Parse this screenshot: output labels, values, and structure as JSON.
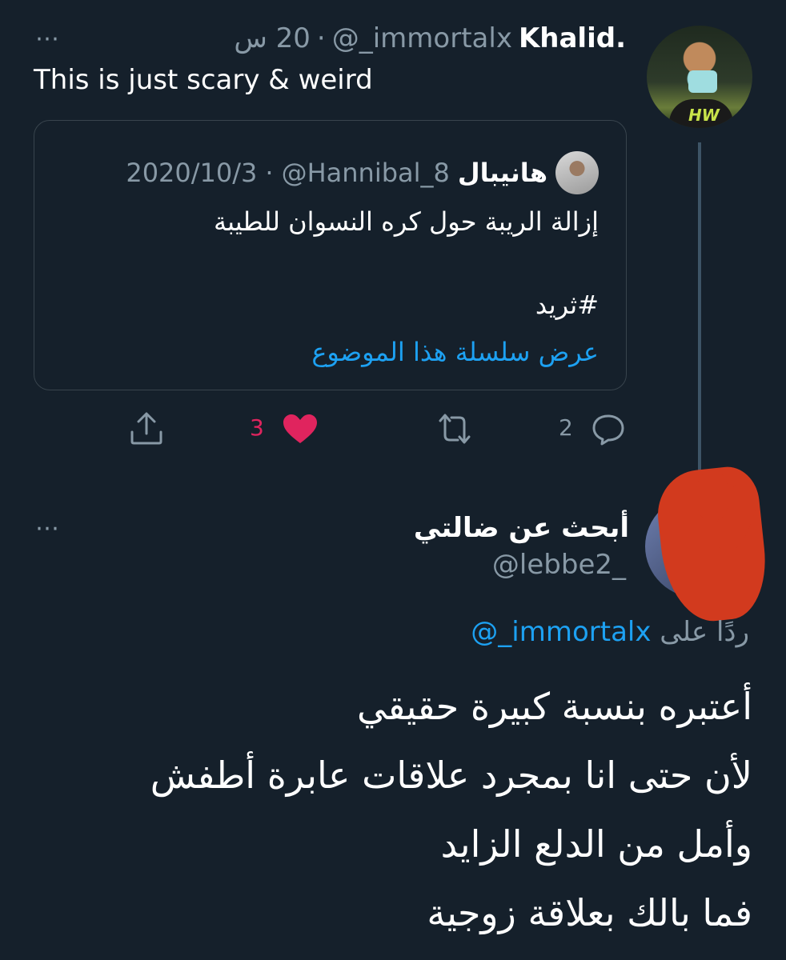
{
  "tweet1": {
    "display_name": "Khalid.",
    "handle": "@_immortalx",
    "separator": "·",
    "time": "20 س",
    "more_icon": "⋯",
    "text": "This is just scary & weird",
    "quoted": {
      "display_name": "هانيبال",
      "handle": "@Hannibal_8",
      "separator": "·",
      "date": "2020/10/3",
      "text_line1": "إزالة الريبة حول كره النسوان للطيبة",
      "text_line2": "#ثريد",
      "show_thread_link": "عرض سلسلة هذا الموضوع"
    },
    "actions": {
      "reply_count": "2",
      "like_count": "3"
    }
  },
  "tweet2": {
    "display_name": "أبحث عن ضالتي",
    "handle": "@lebbe2_",
    "more_icon": "⋯",
    "replying_to_label": "ردًا على",
    "replying_to_mention": "@_immortalx",
    "lines": [
      "أعتبره بنسبة كبيرة حقيقي",
      "لأن حتى انا بمجرد علاقات عابرة أطفش",
      "وأمل من الدلع الزايد",
      "فما بالك بعلاقة زوجية"
    ]
  },
  "colors": {
    "background": "#15202b",
    "muted": "#8899a6",
    "link": "#1da1f2",
    "like": "#e0245e",
    "redaction": "#d23a1e"
  }
}
